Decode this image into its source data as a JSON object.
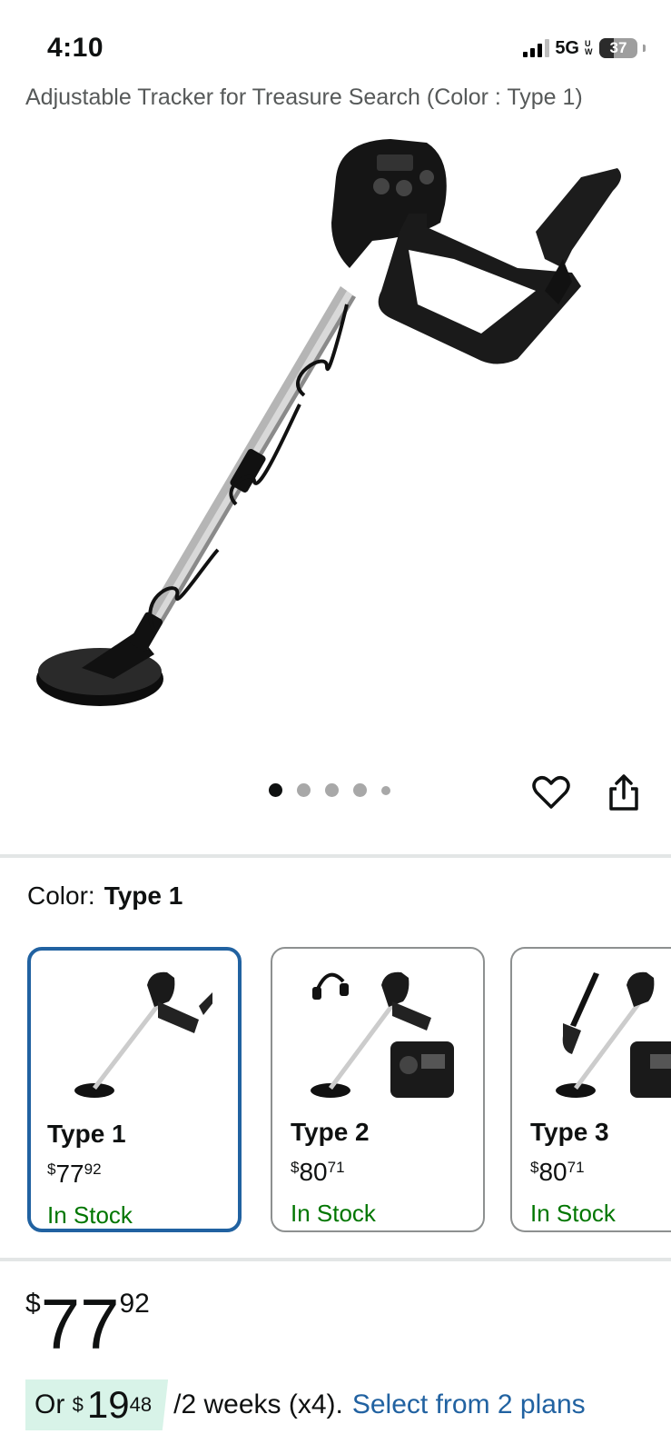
{
  "status_bar": {
    "time": "4:10",
    "network": "5G",
    "network_sub": "UW",
    "battery": "37",
    "battery_level": 0.37
  },
  "product": {
    "title": "Adjustable Tracker for Treasure Search (Color : Type 1)",
    "image_count": 5,
    "active_image_index": 0
  },
  "actions": {
    "wishlist_icon": "heart-icon",
    "share_icon": "share-icon"
  },
  "color": {
    "label": "Color:",
    "selected": "Type 1"
  },
  "variants": [
    {
      "name": "Type 1",
      "currency": "$",
      "price_whole": "77",
      "price_cents": "92",
      "stock": "In Stock",
      "selected": true
    },
    {
      "name": "Type 2",
      "currency": "$",
      "price_whole": "80",
      "price_cents": "71",
      "stock": "In Stock",
      "selected": false
    },
    {
      "name": "Type 3",
      "currency": "$",
      "price_whole": "80",
      "price_cents": "71",
      "stock": "In Stock",
      "selected": false
    }
  ],
  "price": {
    "currency": "$",
    "whole": "77",
    "cents": "92"
  },
  "installment": {
    "prefix": "Or",
    "currency": "$",
    "whole": "19",
    "cents": "48",
    "period": "/2 weeks (x4).",
    "link": "Select from 2 plans"
  },
  "colors": {
    "link": "#2162a1",
    "in_stock": "#007600",
    "selected_border": "#2162a1",
    "installment_bg": "#d8f3e8"
  }
}
